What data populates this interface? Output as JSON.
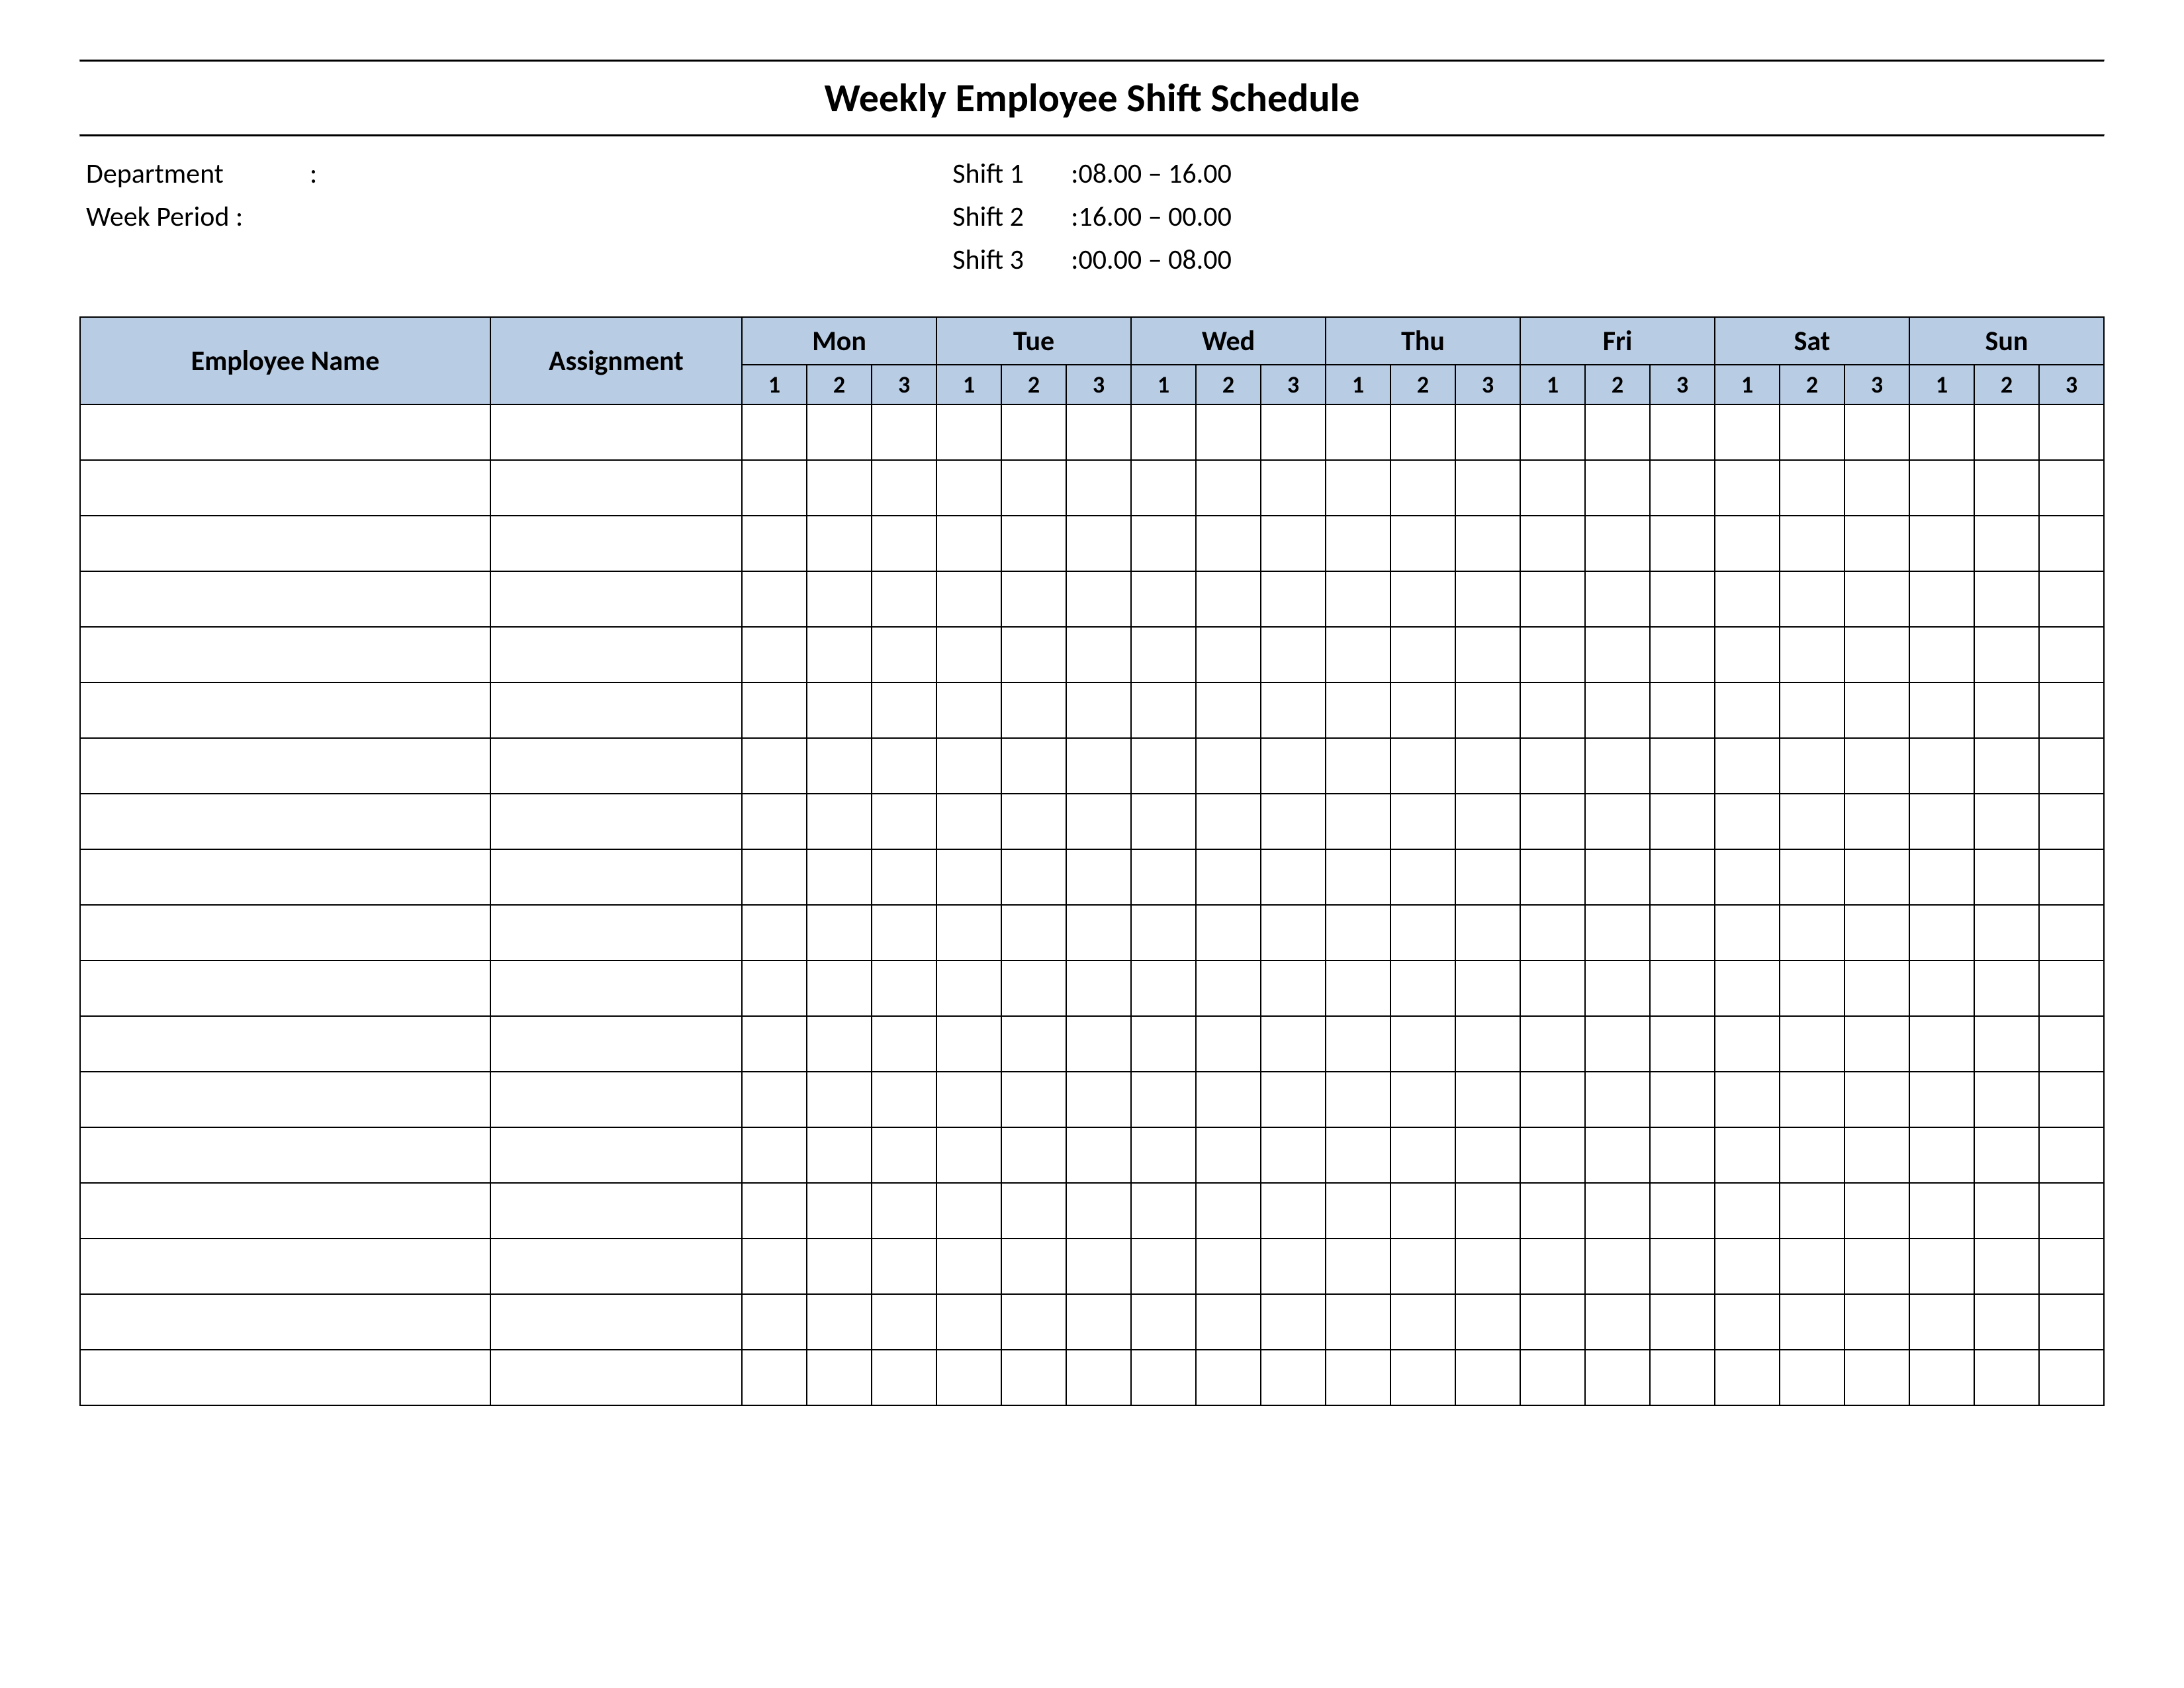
{
  "title": "Weekly Employee Shift Schedule",
  "meta": {
    "department_label": "Department",
    "department_sep": "    :",
    "week_period_label": "Week  Period :",
    "shifts": [
      {
        "label": "Shift 1",
        "sep": "  :",
        "time": " 08.00  – 16.00"
      },
      {
        "label": "Shift 2",
        "sep": "  :",
        "time": " 16.00  – 00.00"
      },
      {
        "label": "Shift 3",
        "sep": "  :",
        "time": " 00.00  – 08.00"
      }
    ]
  },
  "table": {
    "headers": {
      "employee_name": "Employee Name",
      "assignment": "Assignment",
      "days": [
        "Mon",
        "Tue",
        "Wed",
        "Thu",
        "Fri",
        "Sat",
        "Sun"
      ],
      "subshifts": [
        "1",
        "2",
        "3"
      ]
    },
    "rows": [
      {
        "name": "",
        "assignment": "",
        "shifts": [
          "",
          "",
          "",
          "",
          "",
          "",
          "",
          "",
          "",
          "",
          "",
          "",
          "",
          "",
          "",
          "",
          "",
          "",
          "",
          "",
          ""
        ]
      },
      {
        "name": "",
        "assignment": "",
        "shifts": [
          "",
          "",
          "",
          "",
          "",
          "",
          "",
          "",
          "",
          "",
          "",
          "",
          "",
          "",
          "",
          "",
          "",
          "",
          "",
          "",
          ""
        ]
      },
      {
        "name": "",
        "assignment": "",
        "shifts": [
          "",
          "",
          "",
          "",
          "",
          "",
          "",
          "",
          "",
          "",
          "",
          "",
          "",
          "",
          "",
          "",
          "",
          "",
          "",
          "",
          ""
        ]
      },
      {
        "name": "",
        "assignment": "",
        "shifts": [
          "",
          "",
          "",
          "",
          "",
          "",
          "",
          "",
          "",
          "",
          "",
          "",
          "",
          "",
          "",
          "",
          "",
          "",
          "",
          "",
          ""
        ]
      },
      {
        "name": "",
        "assignment": "",
        "shifts": [
          "",
          "",
          "",
          "",
          "",
          "",
          "",
          "",
          "",
          "",
          "",
          "",
          "",
          "",
          "",
          "",
          "",
          "",
          "",
          "",
          ""
        ]
      },
      {
        "name": "",
        "assignment": "",
        "shifts": [
          "",
          "",
          "",
          "",
          "",
          "",
          "",
          "",
          "",
          "",
          "",
          "",
          "",
          "",
          "",
          "",
          "",
          "",
          "",
          "",
          ""
        ]
      },
      {
        "name": "",
        "assignment": "",
        "shifts": [
          "",
          "",
          "",
          "",
          "",
          "",
          "",
          "",
          "",
          "",
          "",
          "",
          "",
          "",
          "",
          "",
          "",
          "",
          "",
          "",
          ""
        ]
      },
      {
        "name": "",
        "assignment": "",
        "shifts": [
          "",
          "",
          "",
          "",
          "",
          "",
          "",
          "",
          "",
          "",
          "",
          "",
          "",
          "",
          "",
          "",
          "",
          "",
          "",
          "",
          ""
        ]
      },
      {
        "name": "",
        "assignment": "",
        "shifts": [
          "",
          "",
          "",
          "",
          "",
          "",
          "",
          "",
          "",
          "",
          "",
          "",
          "",
          "",
          "",
          "",
          "",
          "",
          "",
          "",
          ""
        ]
      },
      {
        "name": "",
        "assignment": "",
        "shifts": [
          "",
          "",
          "",
          "",
          "",
          "",
          "",
          "",
          "",
          "",
          "",
          "",
          "",
          "",
          "",
          "",
          "",
          "",
          "",
          "",
          ""
        ]
      },
      {
        "name": "",
        "assignment": "",
        "shifts": [
          "",
          "",
          "",
          "",
          "",
          "",
          "",
          "",
          "",
          "",
          "",
          "",
          "",
          "",
          "",
          "",
          "",
          "",
          "",
          "",
          ""
        ]
      },
      {
        "name": "",
        "assignment": "",
        "shifts": [
          "",
          "",
          "",
          "",
          "",
          "",
          "",
          "",
          "",
          "",
          "",
          "",
          "",
          "",
          "",
          "",
          "",
          "",
          "",
          "",
          ""
        ]
      },
      {
        "name": "",
        "assignment": "",
        "shifts": [
          "",
          "",
          "",
          "",
          "",
          "",
          "",
          "",
          "",
          "",
          "",
          "",
          "",
          "",
          "",
          "",
          "",
          "",
          "",
          "",
          ""
        ]
      },
      {
        "name": "",
        "assignment": "",
        "shifts": [
          "",
          "",
          "",
          "",
          "",
          "",
          "",
          "",
          "",
          "",
          "",
          "",
          "",
          "",
          "",
          "",
          "",
          "",
          "",
          "",
          ""
        ]
      },
      {
        "name": "",
        "assignment": "",
        "shifts": [
          "",
          "",
          "",
          "",
          "",
          "",
          "",
          "",
          "",
          "",
          "",
          "",
          "",
          "",
          "",
          "",
          "",
          "",
          "",
          "",
          ""
        ]
      },
      {
        "name": "",
        "assignment": "",
        "shifts": [
          "",
          "",
          "",
          "",
          "",
          "",
          "",
          "",
          "",
          "",
          "",
          "",
          "",
          "",
          "",
          "",
          "",
          "",
          "",
          "",
          ""
        ]
      },
      {
        "name": "",
        "assignment": "",
        "shifts": [
          "",
          "",
          "",
          "",
          "",
          "",
          "",
          "",
          "",
          "",
          "",
          "",
          "",
          "",
          "",
          "",
          "",
          "",
          "",
          "",
          ""
        ]
      },
      {
        "name": "",
        "assignment": "",
        "shifts": [
          "",
          "",
          "",
          "",
          "",
          "",
          "",
          "",
          "",
          "",
          "",
          "",
          "",
          "",
          "",
          "",
          "",
          "",
          "",
          "",
          ""
        ]
      }
    ]
  }
}
